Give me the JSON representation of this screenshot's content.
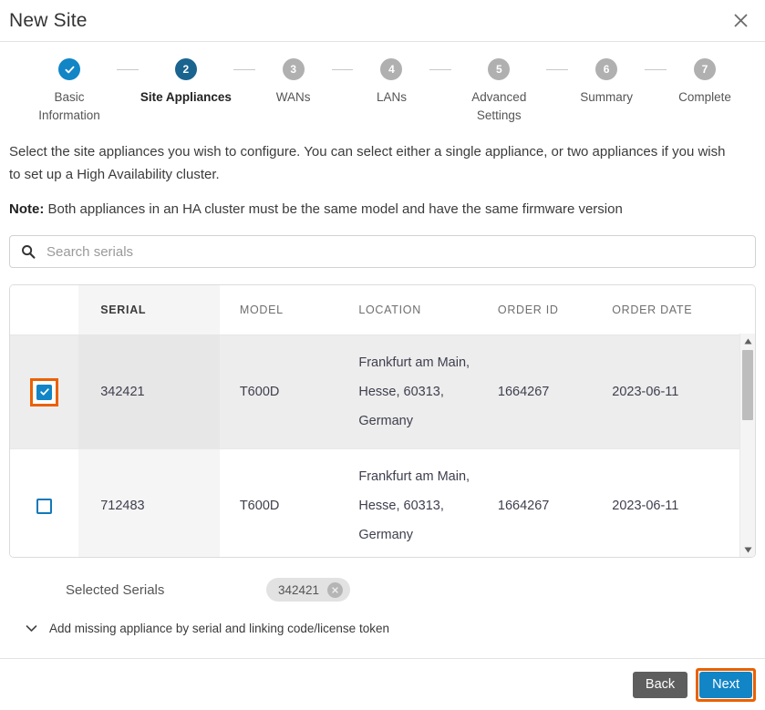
{
  "header": {
    "title": "New Site",
    "close_icon": "close-icon"
  },
  "stepper": {
    "steps": [
      {
        "num": "✓",
        "label": "Basic\nInformation",
        "state": "done"
      },
      {
        "num": "2",
        "label": "Site Appliances",
        "state": "current"
      },
      {
        "num": "3",
        "label": "WANs",
        "state": "upcoming"
      },
      {
        "num": "4",
        "label": "LANs",
        "state": "upcoming"
      },
      {
        "num": "5",
        "label": "Advanced\nSettings",
        "state": "upcoming"
      },
      {
        "num": "6",
        "label": "Summary",
        "state": "upcoming"
      },
      {
        "num": "7",
        "label": "Complete",
        "state": "upcoming"
      }
    ]
  },
  "body": {
    "paragraph": "Select the site appliances you wish to configure. You can select either a single appliance, or two appliances if you wish to set up a High Availability cluster.",
    "note_label": "Note:",
    "note_text": " Both appliances in an HA cluster must be the same model and have the same firmware version"
  },
  "search": {
    "placeholder": "Search serials",
    "value": "",
    "icon": "search-icon"
  },
  "table": {
    "columns": [
      "",
      "SERIAL",
      "MODEL",
      "LOCATION",
      "ORDER ID",
      "ORDER DATE"
    ],
    "rows": [
      {
        "checked": true,
        "focused": true,
        "serial": "342421",
        "model": "T600D",
        "location": "Frankfurt am Main, Hesse, 60313, Germany",
        "order_id": "1664267",
        "order_date": "2023-06-11"
      },
      {
        "checked": false,
        "focused": false,
        "serial": "712483",
        "model": "T600D",
        "location": "Frankfurt am Main, Hesse, 60313, Germany",
        "order_id": "1664267",
        "order_date": "2023-06-11"
      }
    ]
  },
  "selected": {
    "label": "Selected Serials",
    "chips": [
      {
        "text": "342421",
        "remove_icon": "remove-chip-icon"
      }
    ]
  },
  "expander": {
    "label": "Add missing appliance by serial and linking code/license token",
    "icon": "chevron-down-icon"
  },
  "footer": {
    "back_label": "Back",
    "next_label": "Next"
  },
  "colors": {
    "accent_blue": "#1285c6",
    "current_step_blue": "#1a648f",
    "focus_orange": "#ea6100",
    "back_gray": "#5e5e5e",
    "step_gray": "#b0b0b0"
  },
  "scrollbar": {
    "up_icon": "scroll-up-arrow-icon",
    "down_icon": "scroll-down-arrow-icon"
  }
}
